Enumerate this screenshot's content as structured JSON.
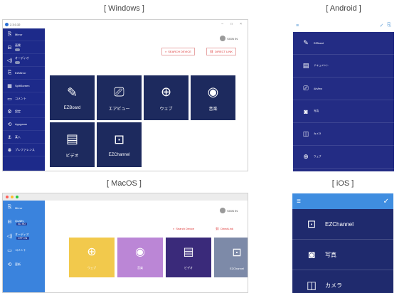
{
  "captions": {
    "windows": "[ Windows ]",
    "android": "[ Android ]",
    "macos": "[ MacOS ]",
    "ios": "[ iOS ]"
  },
  "windows": {
    "version": "2.3.0.32",
    "window_controls": [
      "–",
      "□",
      "×"
    ],
    "sidebar": [
      {
        "icon": "mirror-icon",
        "glyph": "⎘",
        "label": "Mirror",
        "sub": ""
      },
      {
        "icon": "quality-icon",
        "glyph": "⊟",
        "label": "画質",
        "sub": "toggle"
      },
      {
        "icon": "audio-icon",
        "glyph": "◁)",
        "label": "オーディオ",
        "sub": "toggle"
      },
      {
        "icon": "ezmirror-icon",
        "glyph": "⎘",
        "label": "EZMirror",
        "sub": ""
      },
      {
        "icon": "splitscreen-icon",
        "glyph": "▦",
        "label": "SplitScreen",
        "sub": ""
      },
      {
        "icon": "comment-icon",
        "glyph": "▭",
        "label": "コメント",
        "sub": ""
      },
      {
        "icon": "settings-icon",
        "glyph": "⚙",
        "label": "設定",
        "sub": ""
      },
      {
        "icon": "airplay-icon",
        "glyph": "⟲",
        "label": "Appgame",
        "sub": ""
      },
      {
        "icon": "admin-icon",
        "glyph": "⚓",
        "label": "某入",
        "sub": ""
      },
      {
        "icon": "preference-icon",
        "glyph": "⋕",
        "label": "プレファレンス",
        "sub": ""
      }
    ],
    "signin": "SIGN IN",
    "search_device": "SEARCH DEVICE",
    "direct_link": "DIRECT LINK",
    "tiles": [
      {
        "icon": "ezboard-icon",
        "glyph": "✎",
        "label": "EZBoard"
      },
      {
        "icon": "airview-icon",
        "glyph": "⎚",
        "label": "エアビュー"
      },
      {
        "icon": "web-icon",
        "glyph": "⊕",
        "label": "ウェブ"
      },
      {
        "icon": "music-icon",
        "glyph": "◉",
        "label": "音楽"
      },
      {
        "icon": "video-icon",
        "glyph": "▤",
        "label": "ビデオ"
      },
      {
        "icon": "ezchannel-icon",
        "glyph": "⊡",
        "label": "EZChannel"
      }
    ]
  },
  "android": {
    "menu_glyph": "≡",
    "top_right": [
      "✓",
      "⎘"
    ],
    "items": [
      {
        "icon": "ezboard-icon",
        "glyph": "✎",
        "label": "EZBoard"
      },
      {
        "icon": "document-icon",
        "glyph": "▤",
        "label": "ドキュメント"
      },
      {
        "icon": "airview-icon",
        "glyph": "⎚",
        "label": "AirView"
      },
      {
        "icon": "photo-icon",
        "glyph": "◙",
        "label": "写真"
      },
      {
        "icon": "camera-icon",
        "glyph": "◫",
        "label": "カメラ"
      },
      {
        "icon": "web-icon",
        "glyph": "⊕",
        "label": "ウェブ"
      }
    ]
  },
  "macos": {
    "dot_colors": [
      "#ff5f57",
      "#febc2e",
      "#28c840"
    ],
    "sidebar": [
      {
        "icon": "mirror-icon",
        "glyph": "⎘",
        "label": "Mirror",
        "pill": ""
      },
      {
        "icon": "quality-icon",
        "glyph": "⊟",
        "label": "Quality",
        "pill": "SD HD"
      },
      {
        "icon": "audio-icon",
        "glyph": "◁)",
        "label": "オーディオ",
        "pill": "OFF ON"
      },
      {
        "icon": "comment-icon",
        "glyph": "▭",
        "label": "コメント",
        "pill": ""
      },
      {
        "icon": "update-icon",
        "glyph": "⟲",
        "label": "更新",
        "pill": ""
      }
    ],
    "signin": "SIGN IN",
    "search_device": "Search Device",
    "direct_link": "DirectLink",
    "tiles": [
      {
        "icon": "web-icon",
        "glyph": "⊕",
        "label": "ウェブ",
        "color": "#f2c94c"
      },
      {
        "icon": "music-icon",
        "glyph": "◉",
        "label": "音楽",
        "color": "#bb86d6"
      },
      {
        "icon": "video-icon",
        "glyph": "▤",
        "label": "ビデオ",
        "color": "#3a2a7a"
      },
      {
        "icon": "ezchannel-icon",
        "glyph": "⊡",
        "label": "EZChannel",
        "color": "#7d8aa8"
      }
    ]
  },
  "ios": {
    "menu_glyph": "≡",
    "top_right": "✓",
    "items": [
      {
        "icon": "ezchannel-icon",
        "glyph": "⊡",
        "label": "EZChannel"
      },
      {
        "icon": "photo-icon",
        "glyph": "◙",
        "label": "写真"
      },
      {
        "icon": "camera-icon",
        "glyph": "◫",
        "label": "カメラ"
      }
    ]
  }
}
